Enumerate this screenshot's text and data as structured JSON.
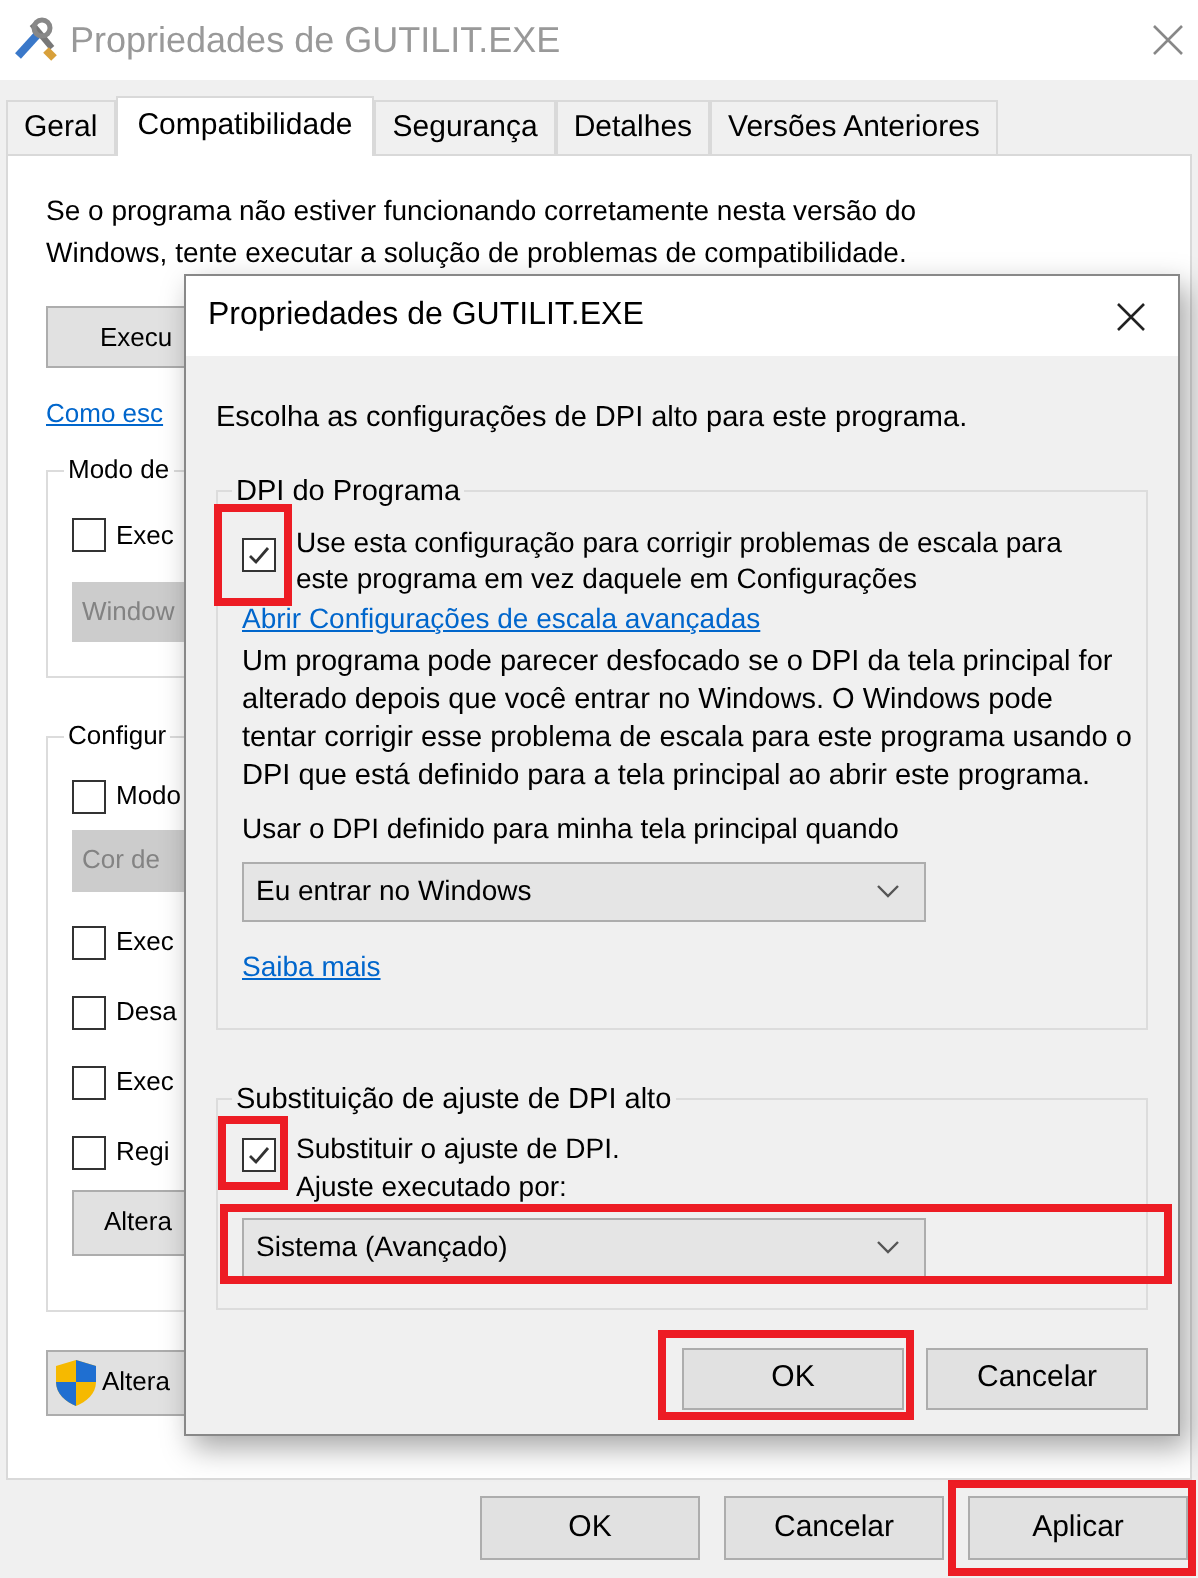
{
  "window": {
    "title": "Propriedades de GUTILIT.EXE"
  },
  "tabs": [
    {
      "label": "Geral",
      "selected": false
    },
    {
      "label": "Compatibilidade",
      "selected": true
    },
    {
      "label": "Segurança",
      "selected": false
    },
    {
      "label": "Detalhes",
      "selected": false
    },
    {
      "label": "Versões Anteriores",
      "selected": false
    }
  ],
  "compatibility": {
    "intro": "Se o programa não estiver funcionando corretamente nesta versão do Windows, tente executar a solução de problemas de compatibilidade.",
    "troubleshoot_button": "Execu",
    "help_link": "Como esc",
    "mode_group": {
      "legend": "Modo de",
      "checkbox": {
        "label": "Exec",
        "checked": false
      },
      "dropdown": {
        "value": "Window",
        "disabled": true
      }
    },
    "settings_group": {
      "legend": "Configur",
      "items": [
        {
          "kind": "checkbox",
          "label": "Modo",
          "checked": false
        },
        {
          "kind": "dropdown",
          "value": "Cor de",
          "disabled": true
        },
        {
          "kind": "checkbox",
          "label": "Exec",
          "checked": false
        },
        {
          "kind": "checkbox",
          "label": "Desa",
          "checked": false
        },
        {
          "kind": "checkbox",
          "label": "Exec",
          "checked": false
        },
        {
          "kind": "checkbox",
          "label": "Regi",
          "checked": false
        },
        {
          "kind": "button",
          "label": "Altera"
        }
      ]
    },
    "all_users_button": "Altera"
  },
  "buttons": [
    {
      "label": "OK",
      "highlighted": false
    },
    {
      "label": "Cancelar",
      "highlighted": false
    },
    {
      "label": "Aplicar",
      "highlighted": true
    }
  ],
  "dialog": {
    "title": "Propriedades de GUTILIT.EXE",
    "intro": "Escolha as configurações de DPI alto para este programa.",
    "program_dpi": {
      "legend": "DPI do Programa",
      "checkbox": {
        "label": "Use esta configuração para corrigir problemas de escala para este programa em vez daquele em Configurações",
        "checked": true,
        "highlighted": true
      },
      "link": "Abrir Configurações de escala avançadas",
      "description": "Um programa pode parecer desfocado se o DPI da tela principal for alterado depois que você entrar no Windows. O Windows pode tentar corrigir esse problema de escala para este programa usando o DPI que está definido para a tela principal ao abrir este programa.",
      "dropdown_label": "Usar o DPI definido para minha tela principal quando",
      "dropdown": {
        "value": "Eu entrar no Windows",
        "highlighted": false
      },
      "learn_more": "Saiba mais"
    },
    "override": {
      "legend": "Substituição de ajuste de DPI alto",
      "checkbox": {
        "label": "Substituir o ajuste de DPI.",
        "checked": true,
        "highlighted": true
      },
      "dropdown_label": "Ajuste executado por:",
      "dropdown": {
        "value": "Sistema (Avançado)",
        "highlighted": true
      }
    },
    "buttons": [
      {
        "label": "OK",
        "highlighted": true
      },
      {
        "label": "Cancelar",
        "highlighted": false
      }
    ]
  }
}
